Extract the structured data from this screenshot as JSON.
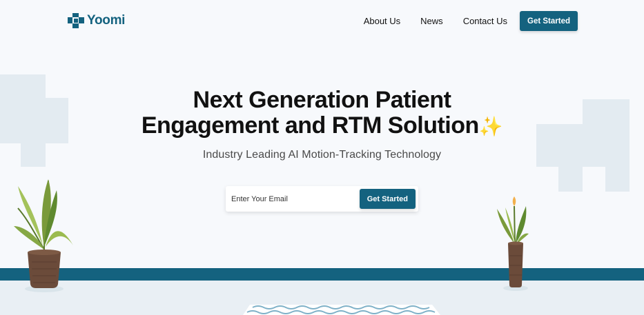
{
  "brand": {
    "name": "Yoomi",
    "color": "#14627f"
  },
  "nav": {
    "items": [
      "About Us",
      "News",
      "Contact Us"
    ],
    "cta_label": "Get Started"
  },
  "hero": {
    "title_bold": "Next Generation",
    "title_rest_line1": " Patient",
    "title_line2": "Engagement and RTM Solution",
    "sparkle": "✨",
    "subtitle": "Industry Leading AI Motion-Tracking Technology"
  },
  "signup": {
    "email_placeholder": "Enter Your Email",
    "button_label": "Get Started"
  },
  "colors": {
    "accent": "#14627f",
    "background": "#f7f9fc",
    "block": "#e3ebf1"
  }
}
